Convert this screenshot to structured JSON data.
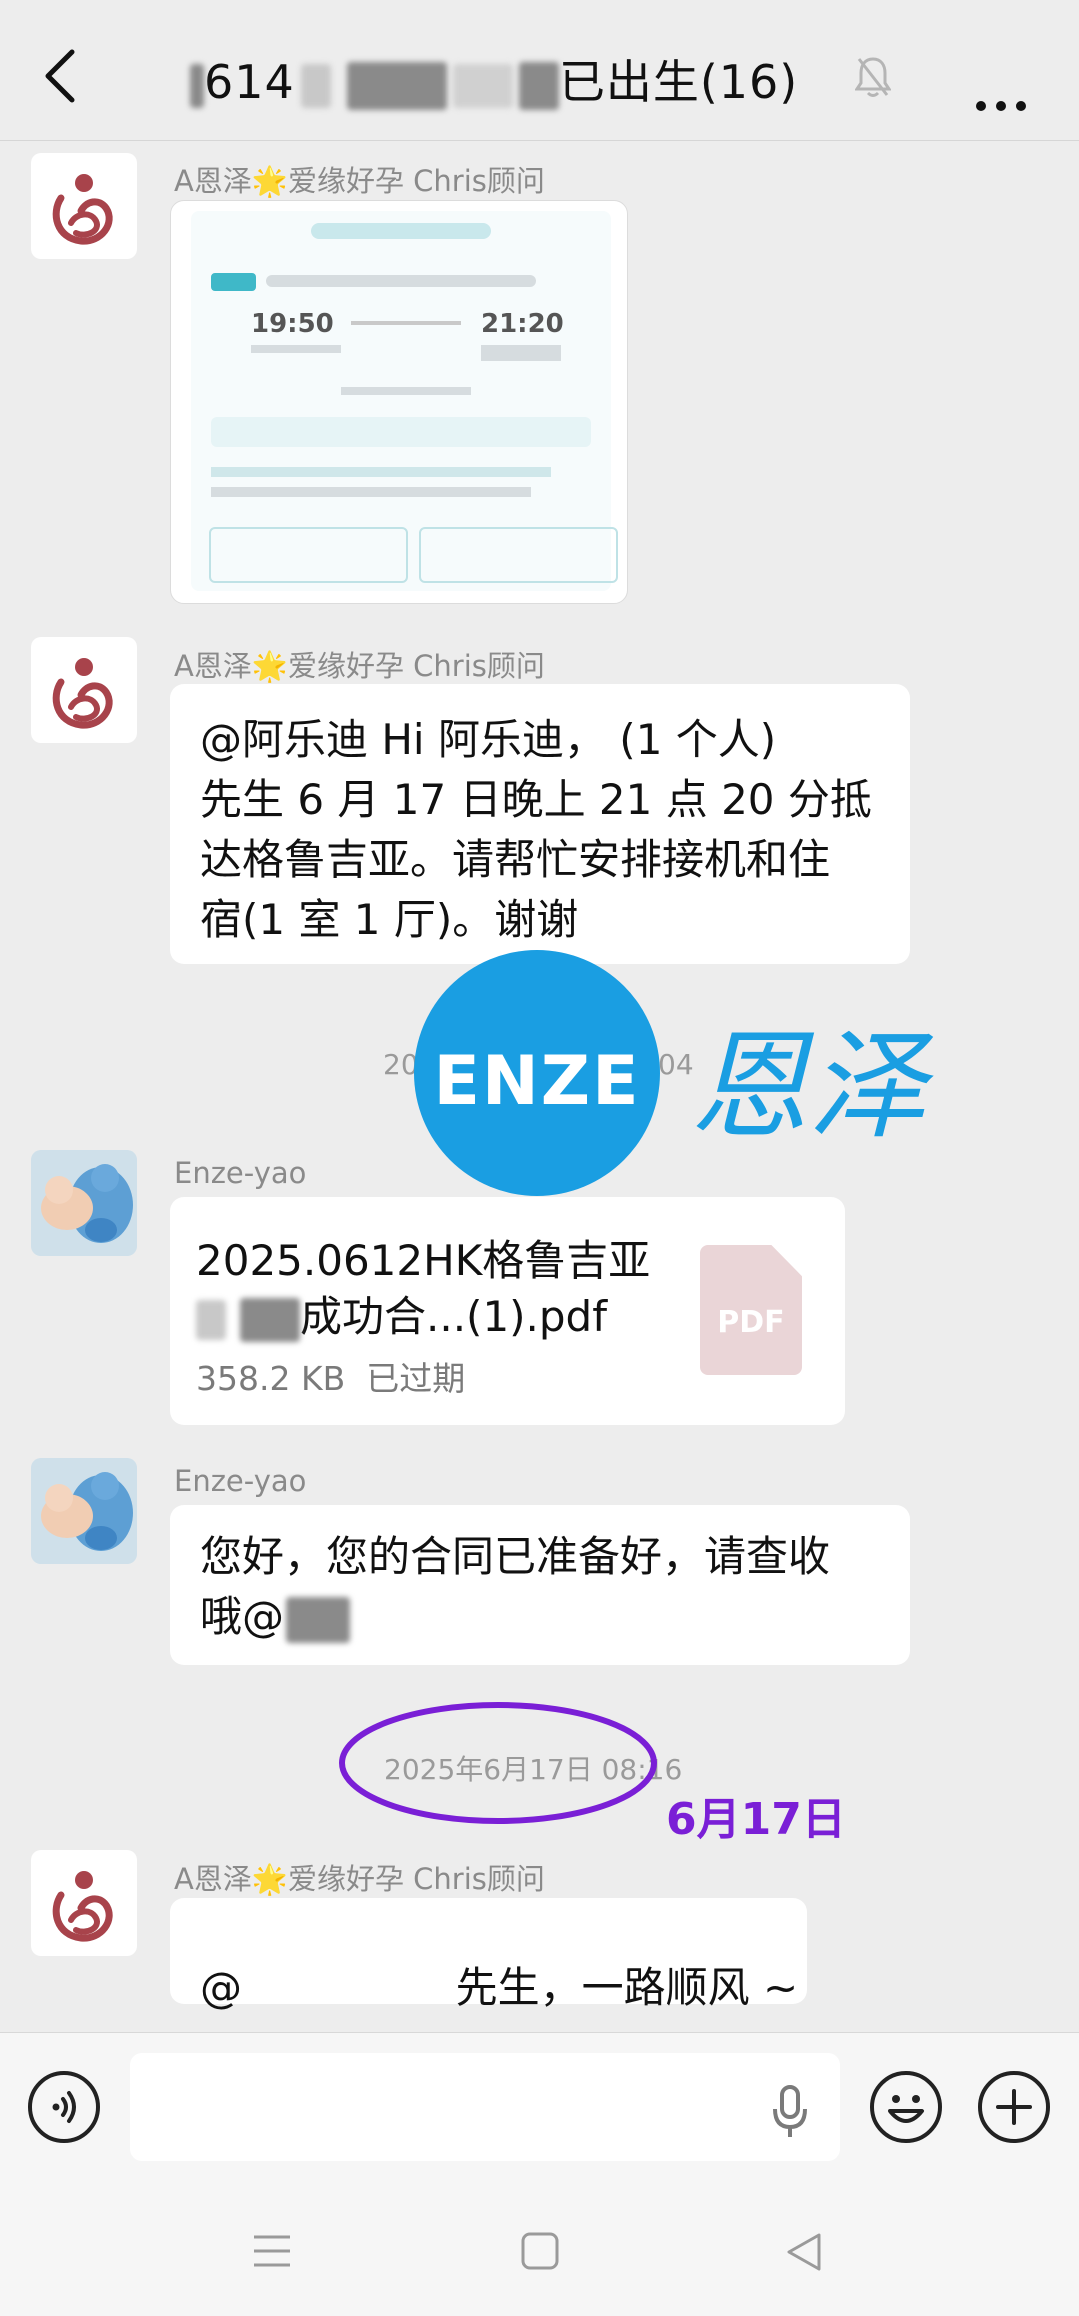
{
  "header": {
    "title_prefix": "614",
    "title_suffix": "已出生(16)"
  },
  "messages": [
    {
      "sender": "A恩泽🌟爱缘好孕 Chris顾问",
      "type": "image",
      "image_text": {
        "departure_time": "19:50",
        "arrival_time": "21:20"
      }
    },
    {
      "sender": "A恩泽🌟爱缘好孕 Chris顾问",
      "type": "text",
      "lines": [
        "@阿乐迪  Hi 阿乐迪，      (1 个人)",
        "先生 6 月 17 日晚上 21 点 20 分抵",
        "达格鲁吉亚。请帮忙安排接机和住",
        "宿(1 室 1 厅)。谢谢"
      ]
    },
    {
      "sender": "Enze-yao",
      "type": "file",
      "file_name_line1": "2025.0612HK格鲁吉亚",
      "file_name_line2": "成功合...(1).pdf",
      "file_size": "358.2 KB",
      "file_status": "已过期",
      "file_icon": "PDF"
    },
    {
      "sender": "Enze-yao",
      "type": "text",
      "lines": [
        "您好，您的合同已准备好，请查收",
        "哦@"
      ]
    },
    {
      "sender": "A恩泽🌟爱缘好孕 Chris顾问",
      "type": "text",
      "lines": [
        "@                先生，一路顺风 ~"
      ]
    }
  ],
  "timestamps": {
    "partial": "20",
    "partial_right": "04",
    "june17": "2025年6月17日 08:16"
  },
  "watermark": {
    "logo": "ENZE",
    "chinese": "恩泽"
  },
  "annotation": {
    "text": "6月17日",
    "color": "#7a1fd6"
  },
  "colors": {
    "accent_blue": "#1a9ee2",
    "logo_red": "#a8434b"
  },
  "icons": [
    "back-arrow-icon",
    "mute-bell-icon",
    "more-icon",
    "voice-icon",
    "mic-icon",
    "emoji-icon",
    "plus-icon",
    "menu-nav-icon",
    "home-nav-icon",
    "back-nav-icon"
  ]
}
